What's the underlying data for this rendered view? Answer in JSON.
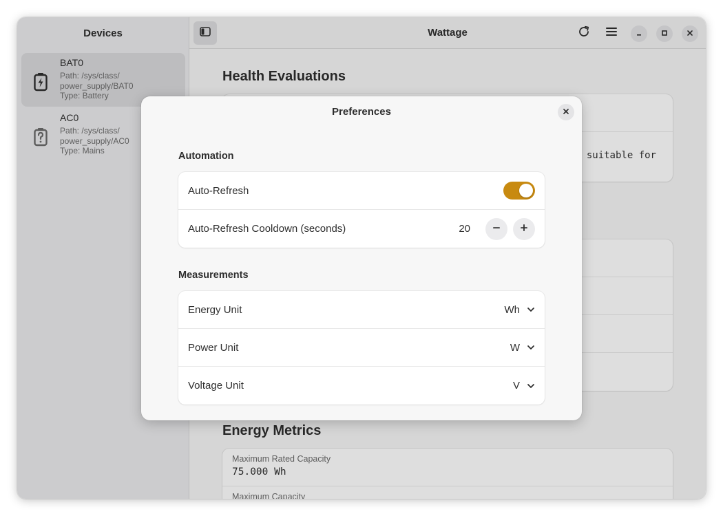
{
  "sidebar": {
    "title": "Devices",
    "devices": [
      {
        "name": "BAT0",
        "path_line1": "Path: /sys/class/",
        "path_line2": "power_supply/BAT0",
        "type": "Type: Battery",
        "icon": "battery-charging-icon",
        "selected": true
      },
      {
        "name": "AC0",
        "path_line1": "Path: /sys/class/",
        "path_line2": "power_supply/AC0",
        "type": "Type: Mains",
        "icon": "battery-unknown-icon",
        "selected": false
      }
    ]
  },
  "header": {
    "title": "Wattage",
    "icons": [
      "sidebar-toggle-icon",
      "refresh-icon",
      "menu-icon",
      "minimize-icon",
      "maximize-icon",
      "close-icon"
    ]
  },
  "main": {
    "health_title": "Health Evaluations",
    "health_partial_text": "suitable for",
    "energy_title": "Energy Metrics",
    "metrics": [
      {
        "label": "Maximum Rated Capacity",
        "value": "75.000 Wh"
      },
      {
        "label": "Maximum Capacity",
        "value": ""
      }
    ]
  },
  "preferences": {
    "title": "Preferences",
    "automation": {
      "title": "Automation",
      "auto_refresh_label": "Auto-Refresh",
      "auto_refresh_on": true,
      "cooldown_label": "Auto-Refresh Cooldown (seconds)",
      "cooldown_value": "20"
    },
    "measurements": {
      "title": "Measurements",
      "rows": [
        {
          "label": "Energy Unit",
          "value": "Wh"
        },
        {
          "label": "Power Unit",
          "value": "W"
        },
        {
          "label": "Voltage Unit",
          "value": "V"
        }
      ]
    }
  },
  "colors": {
    "accent": "#c88a10"
  }
}
